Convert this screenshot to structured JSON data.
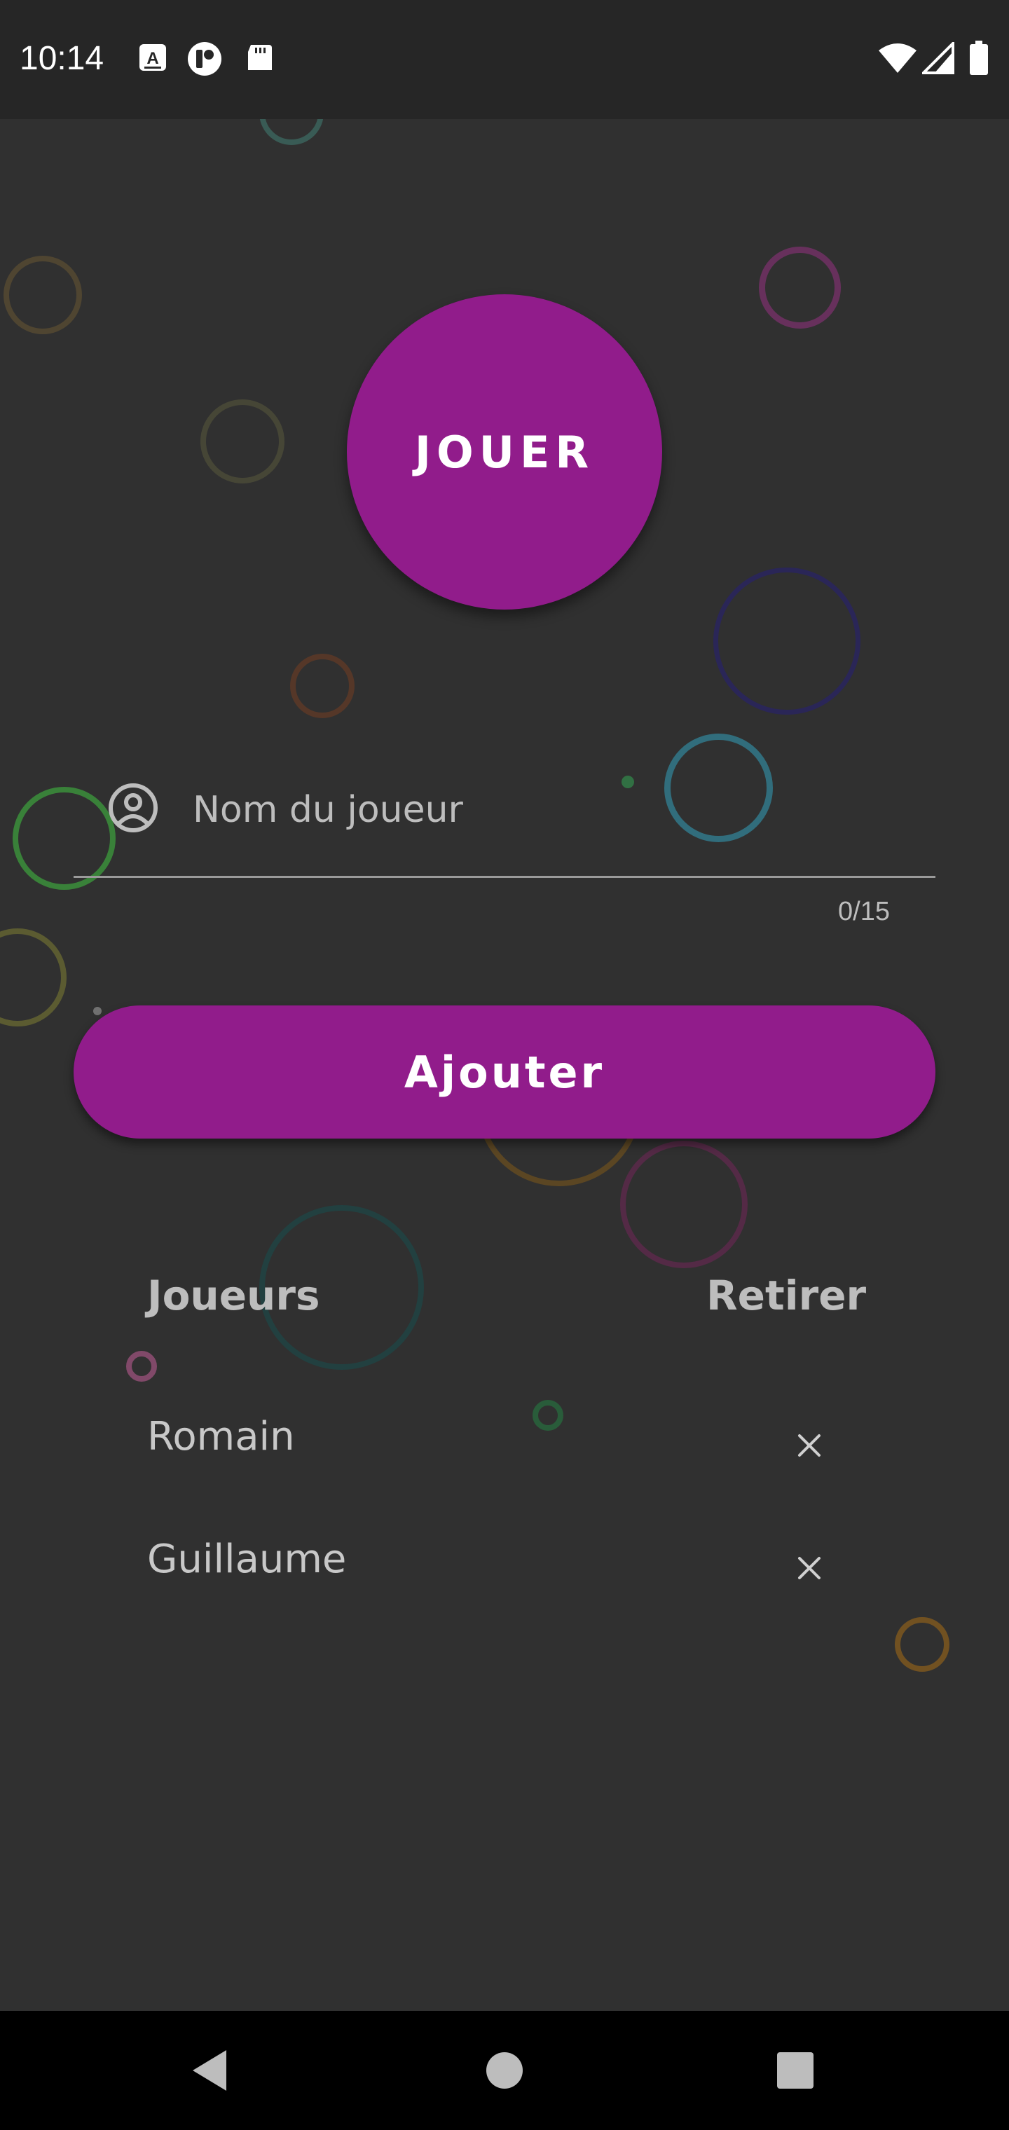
{
  "status_bar": {
    "time": "10:14",
    "left_icons": [
      "keyboard-a-icon",
      "app-notification-icon",
      "sd-card-icon"
    ],
    "right_icons": [
      "wifi-icon",
      "signal-icon",
      "battery-icon"
    ]
  },
  "play_button": {
    "label": "JOUER"
  },
  "name_field": {
    "placeholder": "Nom du joueur",
    "value": "",
    "counter": "0/15",
    "icon": "account-circle-icon"
  },
  "add_button": {
    "label": "Ajouter"
  },
  "players_table": {
    "header_players": "Joueurs",
    "header_remove": "Retirer",
    "rows": [
      {
        "name": "Romain",
        "remove_symbol": "✕"
      },
      {
        "name": "Guillaume",
        "remove_symbol": "✕"
      }
    ]
  },
  "nav_bar": {
    "icons": [
      "back-icon",
      "home-icon",
      "recents-icon"
    ]
  },
  "colors": {
    "accent": "#911c8b",
    "background": "#303030",
    "text_muted": "#bdbdbd"
  }
}
